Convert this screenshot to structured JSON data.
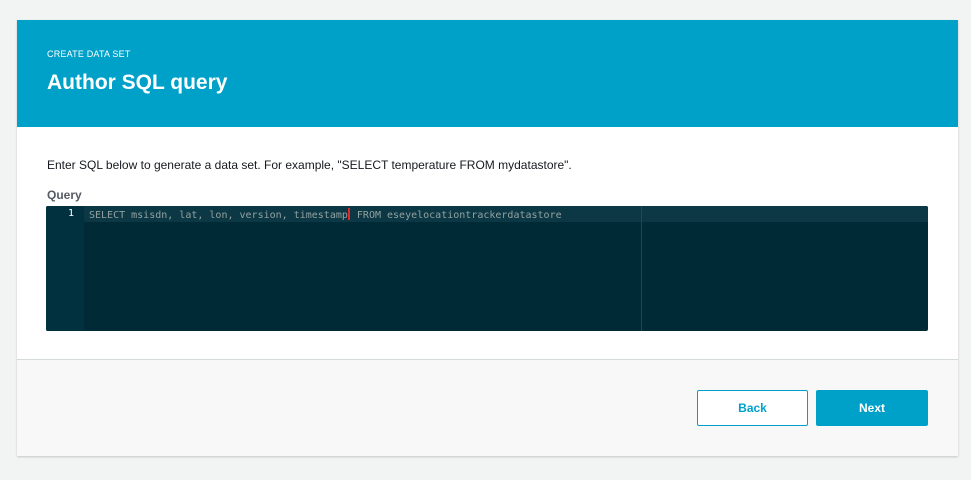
{
  "header": {
    "eyebrow": "CREATE DATA SET",
    "title": "Author SQL query",
    "background_color": "#00a1c9"
  },
  "body": {
    "description": "Enter SQL below to generate a data set. For example, \"SELECT temperature FROM mydatastore\".",
    "query_label": "Query"
  },
  "editor": {
    "lines": [
      {
        "number": "1",
        "text_before_cursor": "SELECT msisdn, lat, lon, version, timestamp",
        "text_after_cursor": "FROM eseyelocationtrackerdatastore"
      }
    ],
    "background_color": "#002b36"
  },
  "footer": {
    "back_label": "Back",
    "next_label": "Next"
  }
}
